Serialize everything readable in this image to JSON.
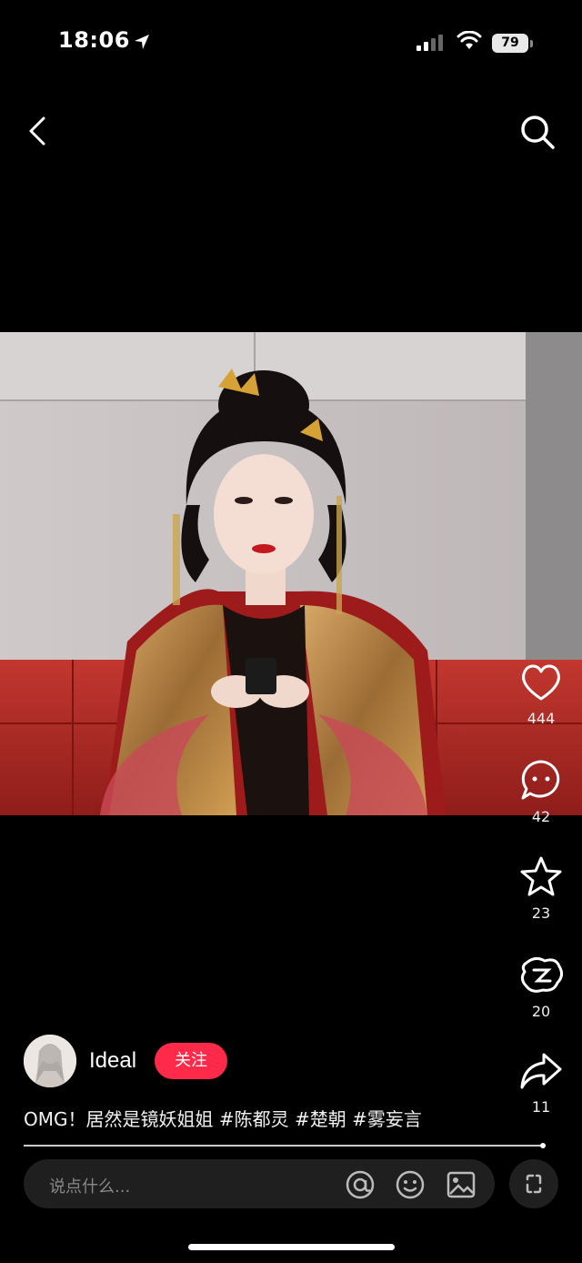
{
  "status": {
    "time": "18:06",
    "battery": "79"
  },
  "post": {
    "author": "Ideal",
    "follow_label": "关注",
    "caption_text": "OMG！居然是镜妖姐姐",
    "hashtags": [
      "#陈都灵",
      "#楚朝",
      "#雾妄言"
    ]
  },
  "actions": {
    "likes": "444",
    "comments": "42",
    "favorites": "23",
    "shares_alt": "20",
    "shares": "11"
  },
  "comment": {
    "placeholder": "说点什么..."
  },
  "icons": [
    "back-icon",
    "search-icon",
    "heart-icon",
    "comment-icon",
    "star-icon",
    "shake-icon",
    "share-icon",
    "at-icon",
    "emoji-icon",
    "image-icon",
    "expand-icon",
    "location-arrow-icon",
    "wifi-icon",
    "signal-icon"
  ],
  "colors": {
    "accent": "#ff2a49",
    "background": "#000000"
  }
}
